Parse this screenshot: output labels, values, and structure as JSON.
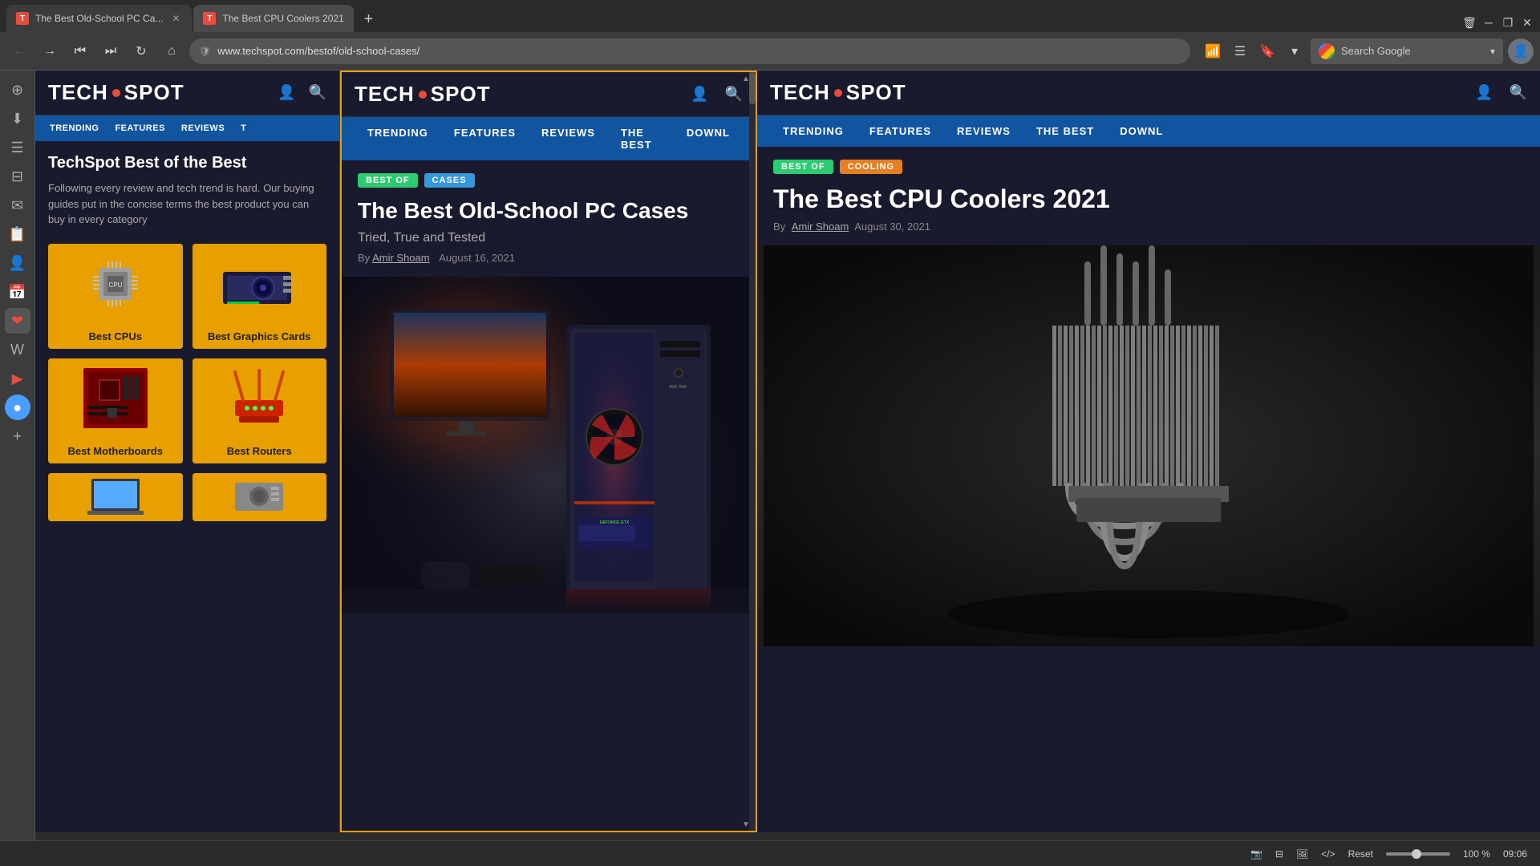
{
  "browser": {
    "tabs": [
      {
        "id": "tab-1",
        "title": "The Best Old-School PC Ca...",
        "favicon_color": "#e74c3c",
        "active": false
      },
      {
        "id": "tab-2",
        "title": "The Best CPU Coolers 2021",
        "favicon_color": "#e74c3c",
        "active": true
      }
    ],
    "address": "www.techspot.com/bestof/old-school-cases/",
    "search_placeholder": "Search Google",
    "window_controls": {
      "trash": "🗑",
      "minimize": "─",
      "maximize": "❐",
      "close": "✕"
    }
  },
  "left_panel": {
    "site_title": "TechSpot",
    "logo_text": "TECHSPOT",
    "nav_items": [
      "TRENDING",
      "FEATURES",
      "REVIEWS",
      "T"
    ],
    "page_title": "TechSpot Best of the Best",
    "description": "Following every review and tech trend is hard. Our buying guides put in the concise terms the best product you can buy in every category",
    "cards": [
      {
        "label": "Best CPUs",
        "icon": "cpu"
      },
      {
        "label": "Best Graphics Cards",
        "icon": "gpu"
      },
      {
        "label": "Best Motherboards",
        "icon": "motherboard"
      },
      {
        "label": "Best Routers",
        "icon": "router"
      }
    ]
  },
  "middle_panel": {
    "site_title": "TECHSPOT",
    "nav_items": [
      "TRENDING",
      "FEATURES",
      "REVIEWS",
      "THE BEST",
      "DOWNL"
    ],
    "badge_best_of": "BEST OF",
    "badge_category": "CASES",
    "article_title": "The Best Old-School PC Cases",
    "article_subtitle": "Tried, True and Tested",
    "author": "Amir Shoam",
    "date": "August 16, 2021",
    "by_label": "By"
  },
  "right_panel": {
    "site_title": "TECHSPOT",
    "nav_items": [
      "TRENDING",
      "FEATURES",
      "REVIEWS",
      "THE BEST",
      "DOWNL"
    ],
    "badge_best_of": "BEST OF",
    "badge_category": "COOLING",
    "article_title": "The Best CPU Coolers 2021",
    "author": "Amir Shoam",
    "date": "August 30, 2021",
    "by_label": "By"
  },
  "status_bar": {
    "reset_label": "Reset",
    "zoom_label": "100 %",
    "time": "09:06"
  },
  "sidebar_icons": [
    "⊕",
    "⬇",
    "☰",
    "✉",
    "👤",
    "📅",
    "❤",
    "W",
    "▶",
    "●",
    "+"
  ]
}
